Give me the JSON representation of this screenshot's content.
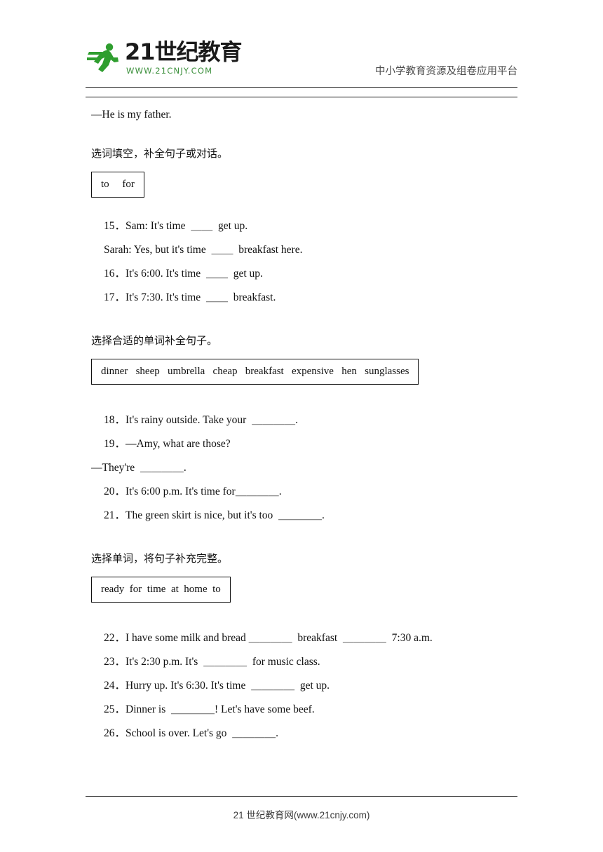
{
  "header": {
    "logo_text": "21世纪教育",
    "logo_url": "WWW.21CNJY.COM",
    "tagline": "中小学教育资源及组卷应用平台",
    "logo_icon": "running-person-icon"
  },
  "content": {
    "answer_line": "—He is my father.",
    "section1": {
      "title": "选词填空，补全句子或对话。",
      "wordbank": "to     for",
      "items": [
        "15．Sam: It's time  ＿＿  get up.",
        "Sarah: Yes, but it's time  ＿＿  breakfast here.",
        "16．It's 6:00. It's time  ＿＿  get up.",
        "17．It's 7:30. It's time  ＿＿  breakfast."
      ]
    },
    "section2": {
      "title": "选择合适的单词补全句子。",
      "wordbank": "dinner   sheep   umbrella   cheap   breakfast   expensive   hen   sunglasses",
      "items": [
        "18．It's rainy outside. Take your  ＿＿＿＿.",
        "19．—Amy, what are those?",
        "—They're  ＿＿＿＿.",
        "20．It's 6:00 p.m. It's time for＿＿＿＿.",
        "21．The green skirt is nice, but it's too  ＿＿＿＿."
      ]
    },
    "section3": {
      "title": "选择单词，将句子补充完整。",
      "wordbank": "ready  for  time  at  home  to",
      "items": [
        "22．I have some milk and bread ＿＿＿＿  breakfast  ＿＿＿＿  7:30 a.m.",
        "23．It's 2:30 p.m. It's  ＿＿＿＿  for music class.",
        "24．Hurry up. It's 6:30. It's time  ＿＿＿＿  get up.",
        "25．Dinner is  ＿＿＿＿! Let's have some beef.",
        "26．School is over. Let's go  ＿＿＿＿."
      ]
    }
  },
  "footer": {
    "text": "21 世纪教育网(www.21cnjy.com)"
  }
}
